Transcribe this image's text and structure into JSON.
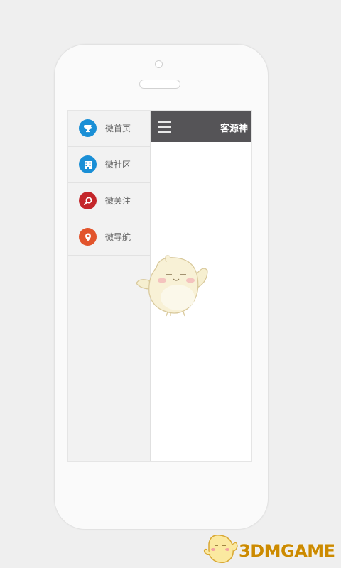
{
  "menu": {
    "items": [
      {
        "label": "微首页",
        "icon": "trophy-icon",
        "color": "#1a8fd6"
      },
      {
        "label": "微社区",
        "icon": "building-icon",
        "color": "#1a8fd6"
      },
      {
        "label": "微关注",
        "icon": "search-icon",
        "color": "#c4262a"
      },
      {
        "label": "微导航",
        "icon": "location-pin-icon",
        "color": "#e2542c"
      }
    ]
  },
  "topbar": {
    "title": "客源神",
    "background": "#555457"
  },
  "watermark": {
    "text": "3DMGAME",
    "color": "#cc8a00"
  }
}
